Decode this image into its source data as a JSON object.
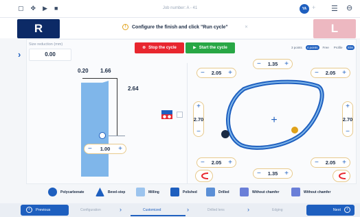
{
  "topbar": {
    "job_title": "Job number: A - 41",
    "avatar_initials": "YA",
    "icons": [
      "square-icon",
      "move-icon",
      "play-icon",
      "stop-icon"
    ]
  },
  "header": {
    "right_tile": "R",
    "left_tile": "L",
    "instruction": "Configure the finish and click \"Run cycle\"",
    "instruction_icon": "info-icon"
  },
  "size_reduction": {
    "label": "Size reduction (mm)",
    "value": "0.00"
  },
  "cycle": {
    "stop_label": "Stop the cycle",
    "start_label": "Start the cycle"
  },
  "view_options": [
    "3 points",
    "4 points",
    "Free",
    "Profile",
    "Slim"
  ],
  "left_drawing": {
    "dim_top_left": "0.20",
    "dim_top_right": "1.66",
    "dim_height": "2.64",
    "bevel_value": "1.00"
  },
  "right_shape": {
    "top": "1.35",
    "bottom": "1.35",
    "upper_left": "2.05",
    "upper_right": "2.05",
    "lower_left": "2.05",
    "lower_right": "2.05",
    "side_left": "2.70",
    "side_right": "2.70",
    "minus": "−",
    "plus": "+"
  },
  "tools": [
    {
      "label": "Polycarbonate",
      "icon": "pc-icon"
    },
    {
      "label": "Bevel-step",
      "icon": "bevel-icon"
    },
    {
      "label": "Milling",
      "icon": "milling-icon"
    },
    {
      "label": "Polished",
      "icon": "polish-icon"
    },
    {
      "label": "Drilled",
      "icon": "drill-icon"
    },
    {
      "label": "Without chamfer",
      "icon": "chamfer-icon"
    },
    {
      "label": "Without chamfer",
      "icon": "chamfer-icon"
    }
  ],
  "steps": [
    "Configuration",
    "Customized",
    "Drilled lens",
    "Edging"
  ],
  "nav": {
    "previous": "Previous",
    "next": "Next"
  },
  "colors": {
    "primary": "#1e5fbf",
    "stop": "#e8262e",
    "start": "#28a745",
    "right_tile": "#0c2a66",
    "left_tile": "#edb8c1",
    "lens": "#7fb6ea"
  }
}
